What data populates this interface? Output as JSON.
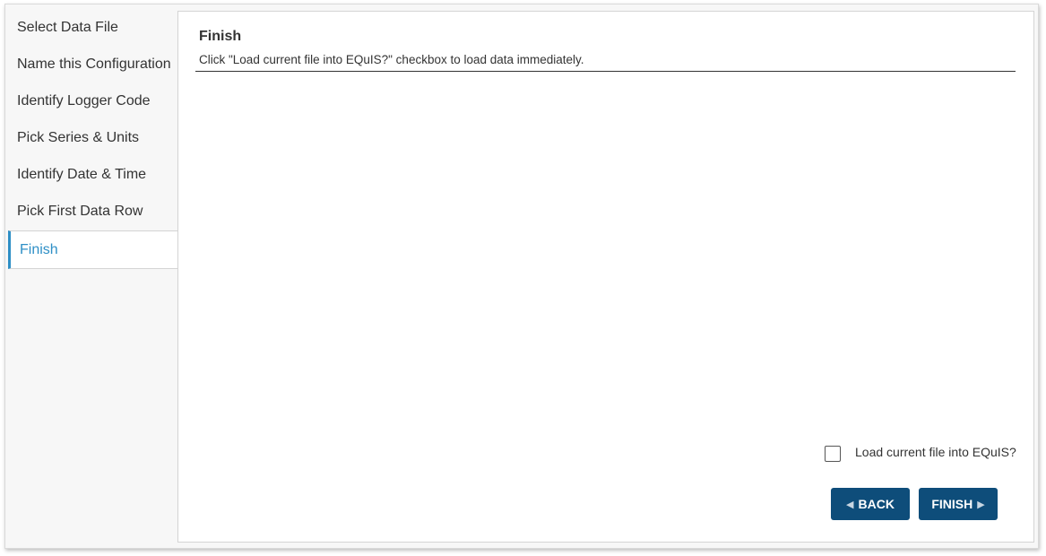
{
  "sidebar": {
    "steps": [
      {
        "label": "Select Data File"
      },
      {
        "label": "Name this Configuration"
      },
      {
        "label": "Identify Logger Code"
      },
      {
        "label": "Pick Series & Units"
      },
      {
        "label": "Identify Date & Time"
      },
      {
        "label": "Pick First Data Row"
      },
      {
        "label": "Finish",
        "active": true
      }
    ]
  },
  "main": {
    "title": "Finish",
    "subtitle": "Click \"Load current file into EQuIS?\" checkbox to load data immediately.",
    "load_checkbox": {
      "label": "Load current file into EQuIS?",
      "checked": false
    },
    "back_label": "BACK",
    "finish_label": "FINISH",
    "back_icon": "triangle-left-icon",
    "finish_icon": "triangle-right-icon"
  },
  "colors": {
    "accent": "#2e8fc6",
    "button": "#0e4d7a"
  }
}
